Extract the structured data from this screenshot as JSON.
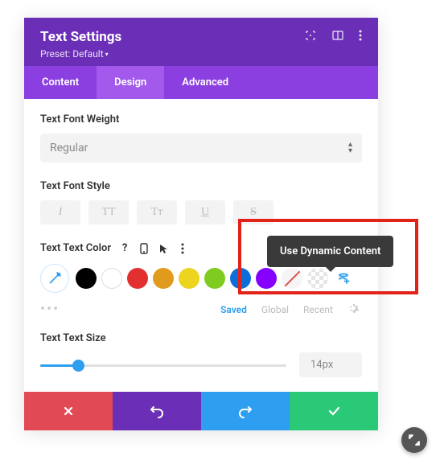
{
  "header": {
    "title": "Text Settings",
    "preset": "Preset: Default"
  },
  "tabs": {
    "content": "Content",
    "design": "Design",
    "advanced": "Advanced"
  },
  "sections": {
    "font_weight_label": "Text Font Weight",
    "font_weight_value": "Regular",
    "font_style_label": "Text Font Style",
    "style_italic": "I",
    "style_upper": "TT",
    "style_cap": "Tᴛ",
    "style_underline": "U",
    "style_strike": "S",
    "text_color_label": "Text Text Color",
    "color_tabs": {
      "saved": "Saved",
      "global": "Global",
      "recent": "Recent"
    },
    "text_size_label": "Text Text Size",
    "text_size_value": "14px"
  },
  "colors": {
    "black": "#000000",
    "white": "#ffffff",
    "red": "#e22f2f",
    "orange": "#e09b1d",
    "yellow": "#ecd41f",
    "green": "#7fcb1f",
    "blue": "#0d6ed8",
    "purple": "#8500ff"
  },
  "tooltip": "Use Dynamic Content"
}
